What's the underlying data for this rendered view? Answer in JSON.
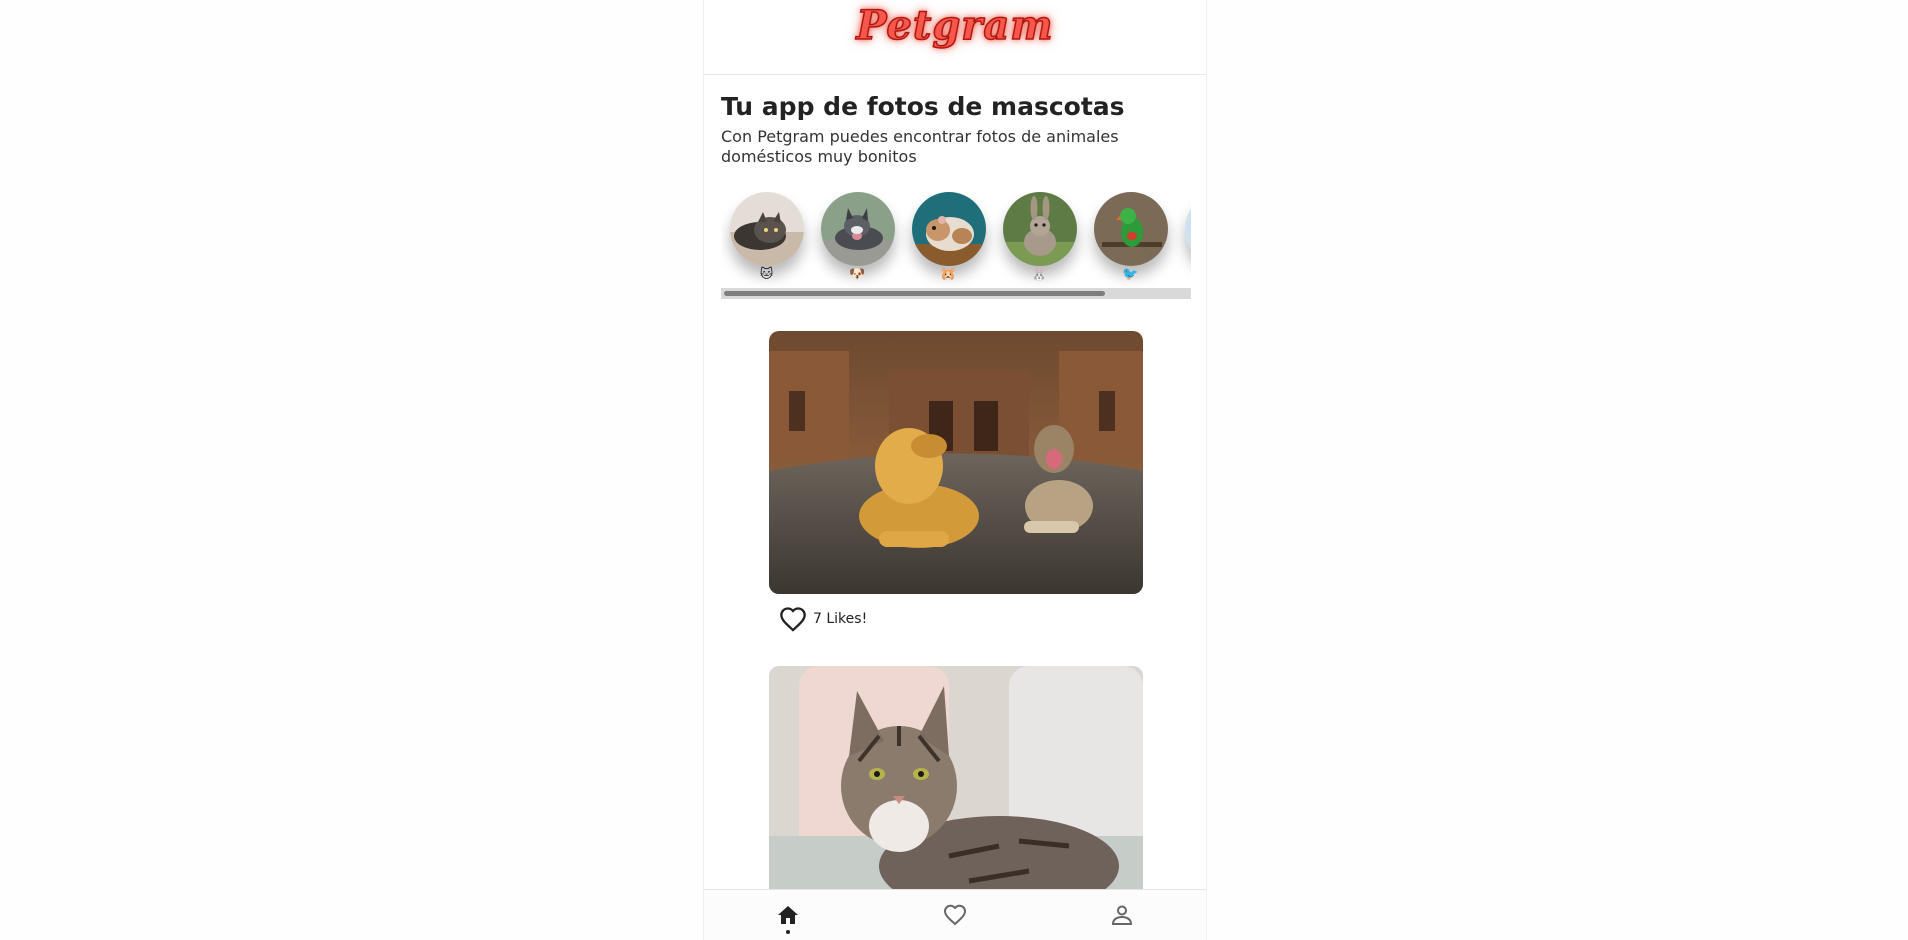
{
  "header": {
    "logo_text": "Petgram"
  },
  "intro": {
    "title": "Tu app de fotos de mascotas",
    "subtitle": "Con Petgram puedes encontrar fotos de animales domésticos muy bonitos"
  },
  "categories": [
    {
      "name": "cat",
      "emoji": "🐱"
    },
    {
      "name": "dog",
      "emoji": "🐶"
    },
    {
      "name": "hamster",
      "emoji": "🐹"
    },
    {
      "name": "rabbit",
      "emoji": "🐰"
    },
    {
      "name": "bird",
      "emoji": "🐦"
    }
  ],
  "feed": [
    {
      "subject": "two dogs lying in front of a cathedral",
      "likes_text": "7 Likes!"
    },
    {
      "subject": "tabby cat lying on a sofa",
      "likes_text": ""
    }
  ],
  "navbar": {
    "items": [
      {
        "name": "home",
        "icon": "home-icon",
        "active": true
      },
      {
        "name": "favs",
        "icon": "heart-outline-icon",
        "active": false
      },
      {
        "name": "user",
        "icon": "user-icon",
        "active": false
      }
    ]
  },
  "colors": {
    "logo": "#f6574d",
    "logo_glow": "#e63c28",
    "text": "#222222"
  }
}
